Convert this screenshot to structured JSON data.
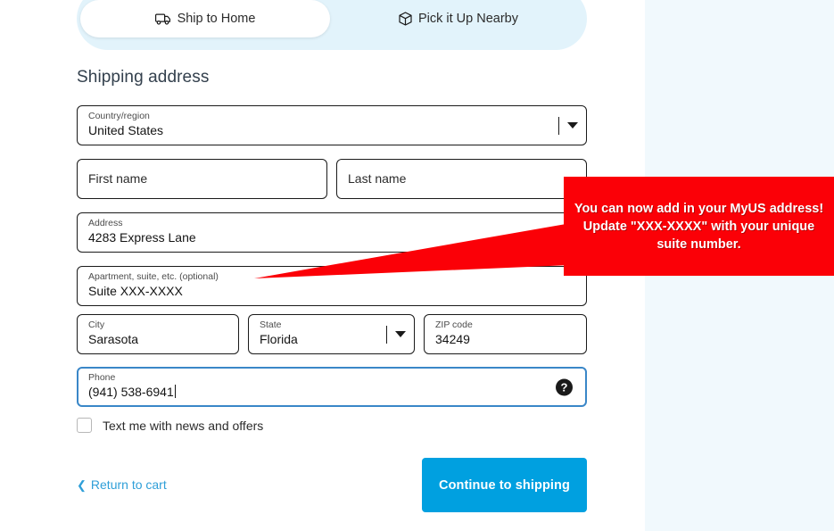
{
  "delivery_toggle": {
    "active_tab": "Ship to Home",
    "tabs": [
      {
        "label": "Ship to Home",
        "icon": "truck-icon",
        "selected": true
      },
      {
        "label": "Pick it Up Nearby",
        "icon": "box-icon",
        "selected": false
      }
    ]
  },
  "section": {
    "title": "Shipping address"
  },
  "form": {
    "country": {
      "label": "Country/region",
      "value": "United States",
      "icon": "chevron-down-icon"
    },
    "first_name": {
      "label": "First name",
      "value": "",
      "placeholder": "First name"
    },
    "last_name": {
      "label": "Last name",
      "value": "",
      "placeholder": "Last name"
    },
    "address": {
      "label": "Address",
      "value": "4283 Express Lane"
    },
    "apartment": {
      "label": "Apartment, suite, etc. (optional)",
      "value": "Suite XXX-XXXX"
    },
    "city": {
      "label": "City",
      "value": "Sarasota"
    },
    "state": {
      "label": "State",
      "value": "Florida",
      "icon": "chevron-down-icon"
    },
    "zip": {
      "label": "ZIP code",
      "value": "34249"
    },
    "phone": {
      "label": "Phone",
      "value": "(941) 538-6941",
      "help_icon": "question-mark-icon",
      "focused": true
    }
  },
  "checkbox": {
    "label": "Text me with news and offers",
    "checked": false
  },
  "actions": {
    "return_link": "Return to cart",
    "return_icon": "chevron-left-icon",
    "continue_button": "Continue to shipping"
  },
  "annotation": {
    "text": "You can now add in your MyUS address! Update \"XXX-XXXX\" with your unique suite number.",
    "box_color": "#fb0007",
    "arrow_color": "#fb0007"
  },
  "colors": {
    "accent_blue": "#00a0e0",
    "link_blue": "#2f9fd8",
    "side_panel": "#f1f9fd",
    "toggle_track": "#e2f3fb",
    "focus_border": "#3a87c8"
  }
}
